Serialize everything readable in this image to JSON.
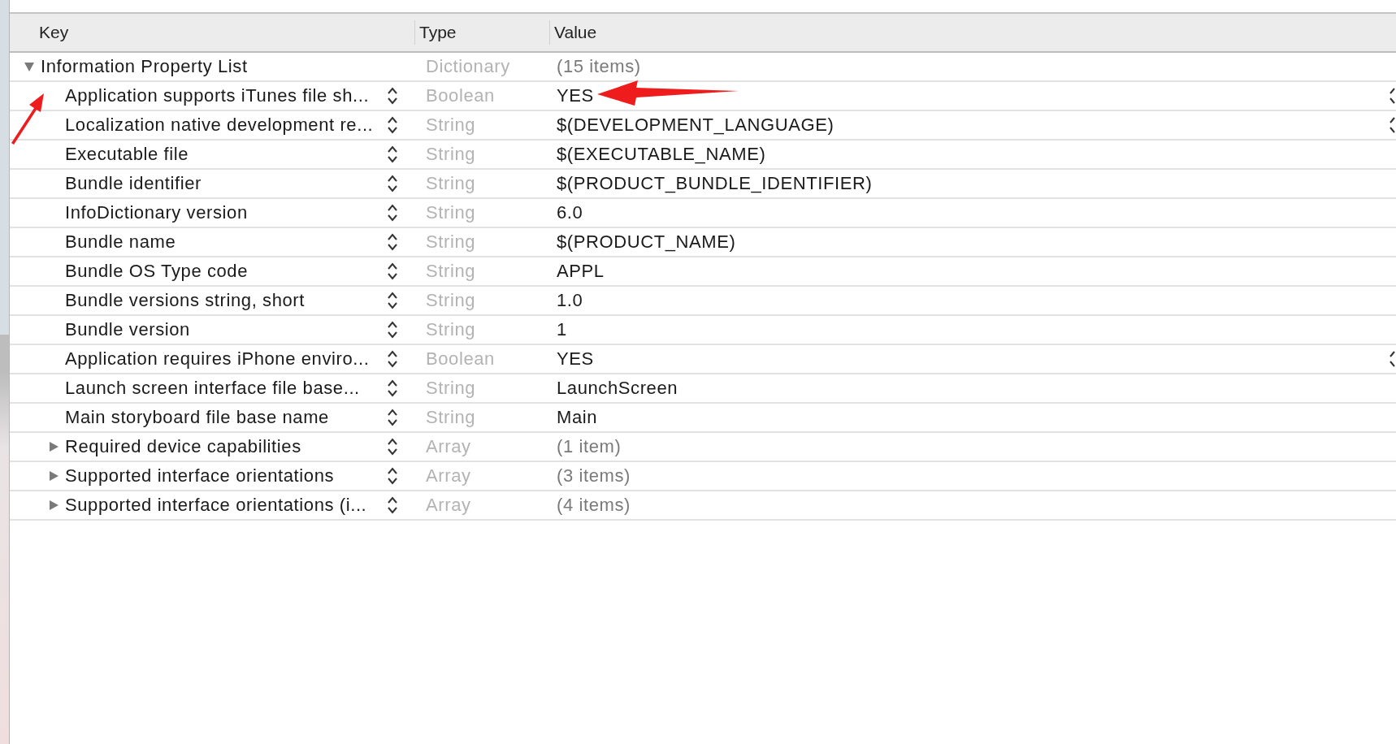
{
  "columns": [
    "Key",
    "Type",
    "Value"
  ],
  "root": {
    "key": "Information Property List",
    "type": "Dictionary",
    "value": "(15 items)",
    "expanded": true,
    "children": [
      {
        "key": "Application supports iTunes file sh...",
        "type": "Boolean",
        "value": "YES",
        "value_popup": true
      },
      {
        "key": "Localization native development re...",
        "type": "String",
        "value": "$(DEVELOPMENT_LANGUAGE)",
        "value_popup": true
      },
      {
        "key": "Executable file",
        "type": "String",
        "value": "$(EXECUTABLE_NAME)",
        "value_popup": false
      },
      {
        "key": "Bundle identifier",
        "type": "String",
        "value": "$(PRODUCT_BUNDLE_IDENTIFIER)",
        "value_popup": false
      },
      {
        "key": "InfoDictionary version",
        "type": "String",
        "value": "6.0",
        "value_popup": false
      },
      {
        "key": "Bundle name",
        "type": "String",
        "value": "$(PRODUCT_NAME)",
        "value_popup": false
      },
      {
        "key": "Bundle OS Type code",
        "type": "String",
        "value": "APPL",
        "value_popup": false
      },
      {
        "key": "Bundle versions string, short",
        "type": "String",
        "value": "1.0",
        "value_popup": false
      },
      {
        "key": "Bundle version",
        "type": "String",
        "value": "1",
        "value_popup": false
      },
      {
        "key": "Application requires iPhone enviro...",
        "type": "Boolean",
        "value": "YES",
        "value_popup": true
      },
      {
        "key": "Launch screen interface file base...",
        "type": "String",
        "value": "LaunchScreen",
        "value_popup": false
      },
      {
        "key": "Main storyboard file base name",
        "type": "String",
        "value": "Main",
        "value_popup": false
      },
      {
        "key": "Required device capabilities",
        "type": "Array",
        "value": "(1 item)",
        "value_popup": false,
        "expanded": false
      },
      {
        "key": "Supported interface orientations",
        "type": "Array",
        "value": "(3 items)",
        "value_popup": false,
        "expanded": false
      },
      {
        "key": "Supported interface orientations (i...",
        "type": "Array",
        "value": "(4 items)",
        "value_popup": false,
        "expanded": false
      }
    ]
  }
}
